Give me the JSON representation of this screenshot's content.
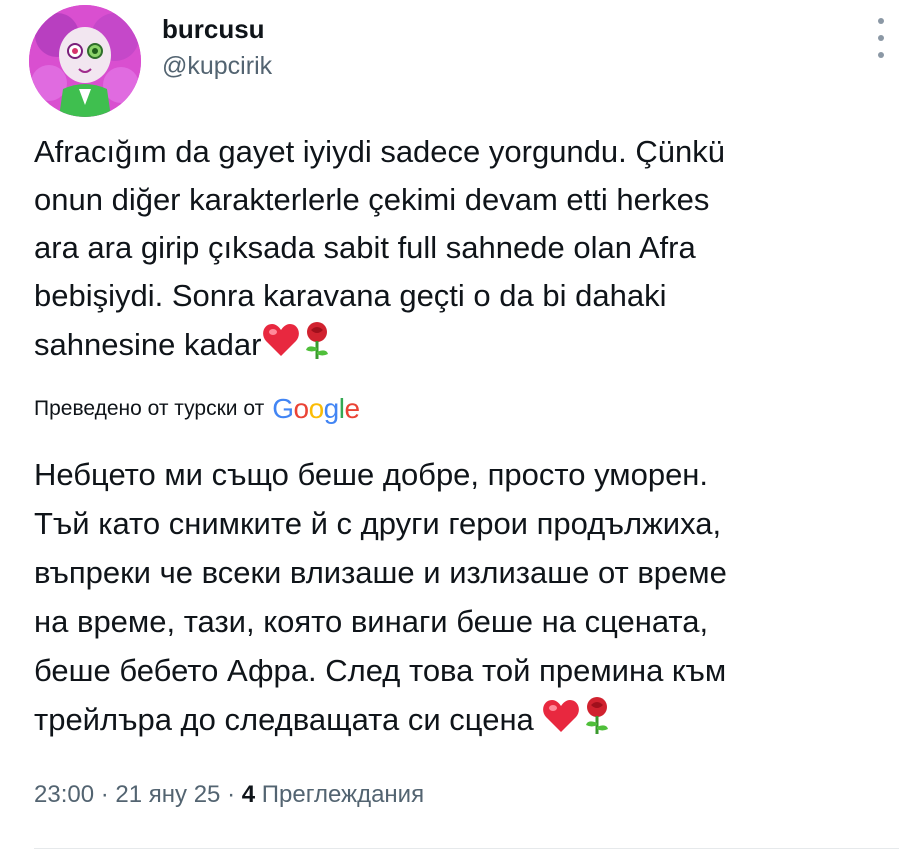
{
  "author": {
    "display_name": "burcusu",
    "handle": "@kupcirik"
  },
  "tweet": {
    "original_text": "Afracığım da gayet iyiydi sadece yorgundu. Çünkü\nonun diğer karakterlerle çekimi devam etti herkes\nara ara girip çıksada sabit full sahnede olan Afra\nbebişiydi. Sonra karavana geçti o da bi dahaki\nsahnesine kadar",
    "translated_label": "Преведено от турски от",
    "translation_provider": "Google",
    "translated_text": "Небцето ми също беше добре, просто уморен.\nТъй като снимките й с други герои продължиха,\nвъпреки че всеки влизаше и излизаше от време\nна време, тази, която винаги беше на сцената,\nбеше бебето Афра. След това той премина към\nтрейлъра до следващата си сцена",
    "emojis": [
      "red-heart",
      "rose"
    ]
  },
  "meta": {
    "time": "23:00",
    "separator": "·",
    "date": "21 яну 25",
    "views_count": "4",
    "views_label": "Преглеждания"
  },
  "colors": {
    "text": "#0f1419",
    "secondary": "#536471",
    "avatar_bg": "#d94fd0"
  }
}
